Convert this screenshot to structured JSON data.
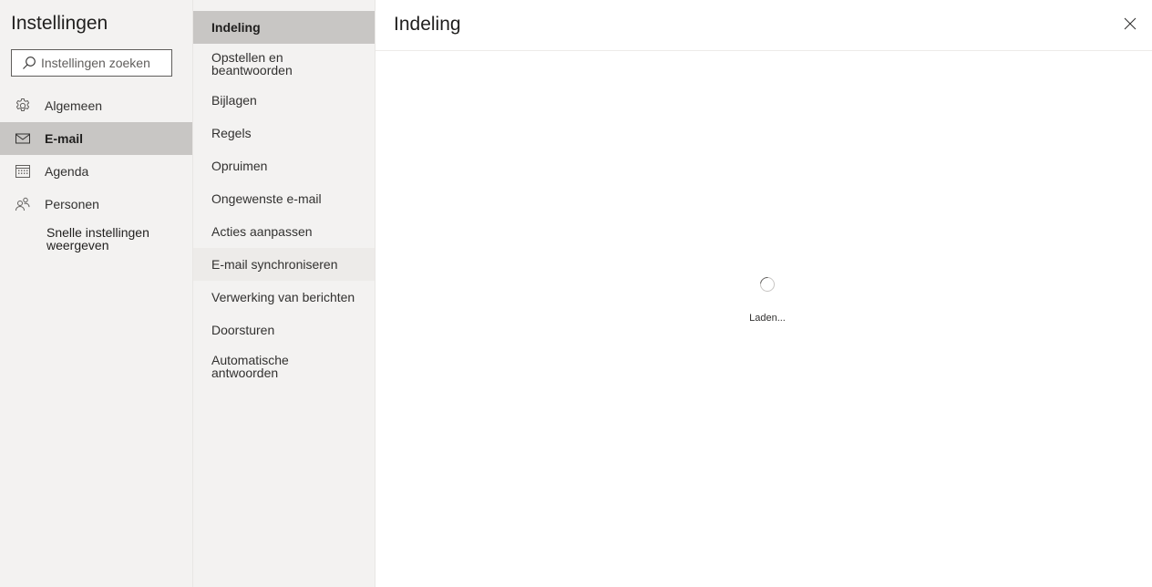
{
  "settings": {
    "title": "Instellingen",
    "search": {
      "placeholder": "Instellingen zoeken",
      "value": "",
      "icon": "search-icon"
    },
    "categories": [
      {
        "label": "Algemeen",
        "icon": "gear-icon",
        "active": false
      },
      {
        "label": "E-mail",
        "icon": "mail-icon",
        "active": true
      },
      {
        "label": "Agenda",
        "icon": "calendar-icon",
        "active": false
      },
      {
        "label": "Personen",
        "icon": "people-icon",
        "active": false
      }
    ],
    "quick_settings_link": "Snelle instellingen weergeven"
  },
  "mail_submenu": {
    "items": [
      {
        "label": "Indeling",
        "selected": true
      },
      {
        "label": "Opstellen en beantwoorden"
      },
      {
        "label": "Bijlagen"
      },
      {
        "label": "Regels"
      },
      {
        "label": "Opruimen"
      },
      {
        "label": "Ongewenste e-mail"
      },
      {
        "label": "Acties aanpassen"
      },
      {
        "label": "E-mail synchroniseren",
        "hovered": true
      },
      {
        "label": "Verwerking van berichten"
      },
      {
        "label": "Doorsturen"
      },
      {
        "label": "Automatische antwoorden"
      }
    ]
  },
  "main": {
    "title": "Indeling",
    "close_icon": "close-icon",
    "loading_text": "Laden..."
  },
  "colors": {
    "pane_background": "#f3f2f1",
    "selected_background": "#c8c6c4",
    "hover_background": "#edebe9",
    "text": "#201f1e"
  }
}
